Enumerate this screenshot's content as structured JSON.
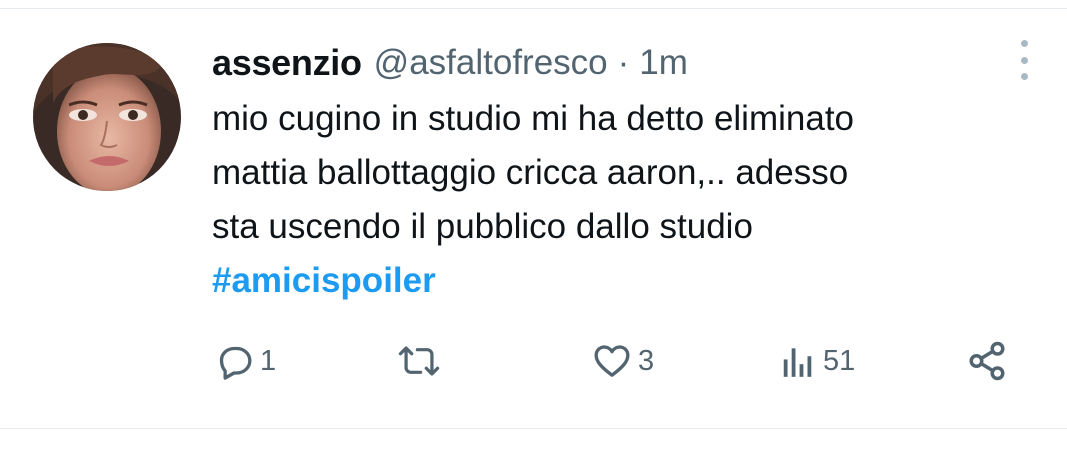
{
  "tweet": {
    "display_name": "assenzio",
    "handle": "@asfaltofresco",
    "separator": "·",
    "time": "1m",
    "text_lines": [
      "mio cugino in studio mi ha detto eliminato",
      "mattia ballottaggio cricca aaron,.. adesso",
      "sta uscendo il pubblico dallo studio"
    ],
    "hashtag": "#amicispoiler"
  },
  "actions": {
    "reply_count": "1",
    "like_count": "3",
    "views_count": "51"
  },
  "icons": {
    "more": "more-vertical-icon",
    "reply": "reply-icon",
    "retweet": "retweet-icon",
    "like": "heart-icon",
    "views": "views-icon",
    "share": "share-icon"
  },
  "colors": {
    "text": "#0f1419",
    "secondary": "#536471",
    "hashtag": "#1d9bf0",
    "divider": "#e6ecf0"
  }
}
